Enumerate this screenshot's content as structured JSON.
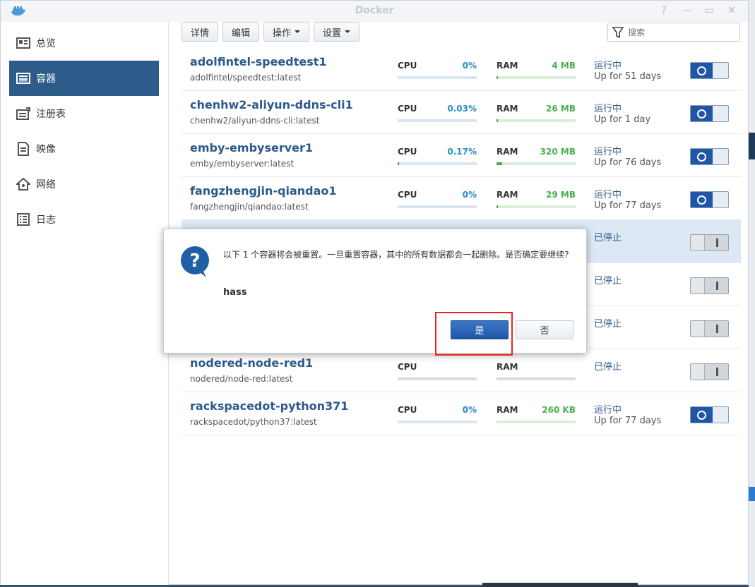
{
  "window": {
    "title": "Docker"
  },
  "sidebar": {
    "items": [
      {
        "label": "总览",
        "icon": "overview-icon"
      },
      {
        "label": "容器",
        "icon": "container-icon",
        "active": true
      },
      {
        "label": "注册表",
        "icon": "registry-icon"
      },
      {
        "label": "映像",
        "icon": "image-icon"
      },
      {
        "label": "网络",
        "icon": "network-icon"
      },
      {
        "label": "日志",
        "icon": "log-icon"
      }
    ]
  },
  "toolbar": {
    "details_label": "详情",
    "edit_label": "编辑",
    "action_label": "操作",
    "settings_label": "设置",
    "search_placeholder": "搜索"
  },
  "labels": {
    "cpu": "CPU",
    "ram": "RAM"
  },
  "containers": [
    {
      "name": "adolfintel-speedtest1",
      "image": "adolfintel/speedtest:latest",
      "cpu": "0%",
      "cpu_fraction": 0.0,
      "ram": "4 MB",
      "ram_fraction": 0.01,
      "status": "运行中",
      "uptime": "Up for 51 days",
      "running": true
    },
    {
      "name": "chenhw2-aliyun-ddns-cli1",
      "image": "chenhw2/aliyun-ddns-cli:latest",
      "cpu": "0.03%",
      "cpu_fraction": 0.0,
      "ram": "26 MB",
      "ram_fraction": 0.01,
      "status": "运行中",
      "uptime": "Up for 1 day",
      "running": true
    },
    {
      "name": "emby-embyserver1",
      "image": "emby/embyserver:latest",
      "cpu": "0.17%",
      "cpu_fraction": 0.01,
      "ram": "320 MB",
      "ram_fraction": 0.07,
      "status": "运行中",
      "uptime": "Up for 76 days",
      "running": true
    },
    {
      "name": "fangzhengjin-qiandao1",
      "image": "fangzhengjin/qiandao:latest",
      "cpu": "0%",
      "cpu_fraction": 0.0,
      "ram": "29 MB",
      "ram_fraction": 0.01,
      "status": "运行中",
      "uptime": "Up for 77 days",
      "running": true
    },
    {
      "name": "",
      "image": "",
      "cpu": "",
      "ram": "",
      "status": "已停止",
      "uptime": "",
      "running": false,
      "selected": true
    },
    {
      "name": "",
      "image": "",
      "cpu": "",
      "ram": "",
      "status": "已停止",
      "uptime": "",
      "running": false
    },
    {
      "name": "",
      "image": "",
      "cpu": "",
      "ram": "",
      "status": "已停止",
      "uptime": "",
      "running": false
    },
    {
      "name": "nodered-node-red1",
      "image": "nodered/node-red:latest",
      "cpu": "",
      "ram": "",
      "status": "已停止",
      "uptime": "",
      "running": false,
      "show_metrics": true
    },
    {
      "name": "rackspacedot-python371",
      "image": "rackspacedot/python37:latest",
      "cpu": "0%",
      "cpu_fraction": 0.0,
      "ram": "260 KB",
      "ram_fraction": 0.0,
      "status": "运行中",
      "uptime": "Up for 77 days",
      "running": true
    }
  ],
  "dialog": {
    "message": "以下 1 个容器将会被重置。一旦重置容器，其中的所有数据都会一起删除。是否确定要继续?",
    "target": "hass",
    "yes_label": "是",
    "no_label": "否"
  },
  "colors": {
    "accent": "#2e5c8a",
    "cpu_value": "#2a8fc8",
    "ram_value": "#4caf50",
    "highlight": "#e8261f"
  }
}
